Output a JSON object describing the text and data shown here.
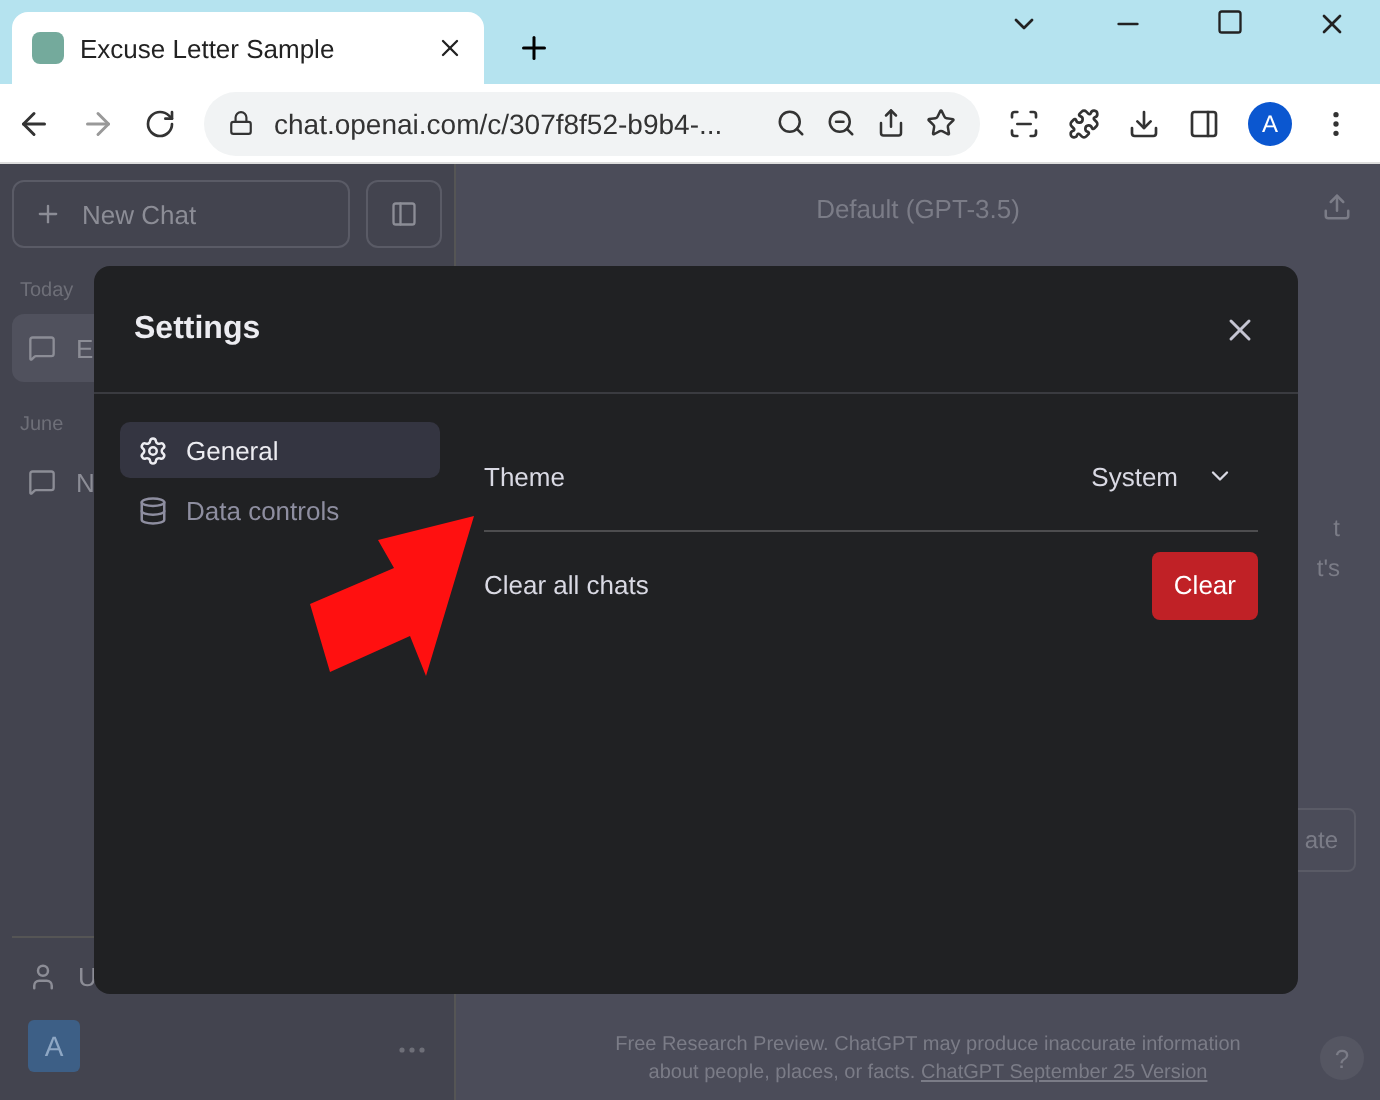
{
  "browser": {
    "tab_title": "Excuse Letter Sample",
    "url": "chat.openai.com/c/307f8f52-b9b4-...",
    "profile": "A"
  },
  "sidebar": {
    "new_chat": "New Chat",
    "groups": [
      {
        "label": "Today",
        "items": [
          {
            "title": "E",
            "selected": true
          }
        ]
      },
      {
        "label": "June",
        "items": [
          {
            "title": "N",
            "selected": false
          }
        ]
      }
    ],
    "user_row": "U",
    "avatar": "A"
  },
  "main": {
    "model": "Default (GPT-3.5)",
    "fragments": [
      "t",
      "t's"
    ],
    "button_fragment": "ate",
    "footer": "Free Research Preview. ChatGPT may produce inaccurate information about people, places, or facts.",
    "footer_link": "ChatGPT September 25 Version",
    "help": "?"
  },
  "settings": {
    "title": "Settings",
    "nav": [
      {
        "label": "General",
        "kind": "gear",
        "selected": true
      },
      {
        "label": "Data controls",
        "kind": "database",
        "selected": false
      }
    ],
    "rows": [
      {
        "label": "Theme",
        "kind": "select",
        "value": "System"
      },
      {
        "label": "Clear all chats",
        "kind": "button",
        "value": "Clear"
      }
    ]
  }
}
